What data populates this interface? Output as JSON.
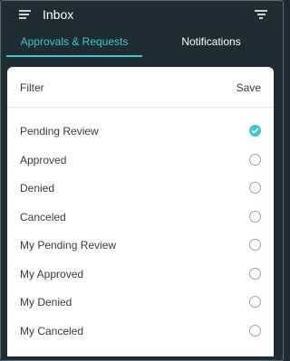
{
  "header": {
    "title": "Inbox"
  },
  "tabs": [
    {
      "label": "Approvals & Requests",
      "active": true
    },
    {
      "label": "Notifications",
      "active": false
    }
  ],
  "filter_sheet": {
    "title": "Filter",
    "save_label": "Save",
    "options": [
      {
        "label": "Pending Review",
        "selected": true
      },
      {
        "label": "Approved",
        "selected": false
      },
      {
        "label": "Denied",
        "selected": false
      },
      {
        "label": "Canceled",
        "selected": false
      },
      {
        "label": "My Pending Review",
        "selected": false
      },
      {
        "label": "My Approved",
        "selected": false
      },
      {
        "label": "My Denied",
        "selected": false
      },
      {
        "label": "My Canceled",
        "selected": false
      }
    ]
  },
  "colors": {
    "background": "#1e2c34",
    "accent": "#45c4c9",
    "sheet": "#ffffff",
    "text": "#333d42"
  },
  "icons": {
    "menu": "hamburger-menu-icon",
    "filter": "filter-funnel-icon",
    "check": "check-circle-icon",
    "radio": "radio-empty-icon"
  }
}
